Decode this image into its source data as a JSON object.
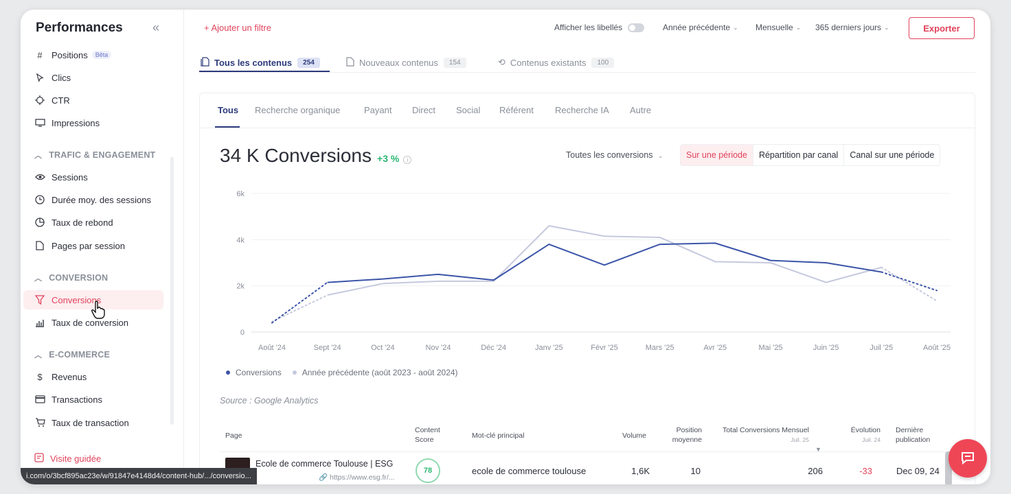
{
  "sidebar": {
    "title": "Performances",
    "collapse_icon": "double-chevron-left-icon",
    "top_items": [
      {
        "label": "Positions",
        "badge": "Bêta",
        "icon": "hash-icon"
      },
      {
        "label": "Clics",
        "icon": "cursor-icon"
      },
      {
        "label": "CTR",
        "icon": "crosshair-icon"
      },
      {
        "label": "Impressions",
        "icon": "monitor-icon"
      }
    ],
    "sections": [
      {
        "title": "TRAFIC & ENGAGEMENT",
        "items": [
          {
            "label": "Sessions",
            "icon": "eye-icon"
          },
          {
            "label": "Durée moy. des sessions",
            "icon": "clock-icon"
          },
          {
            "label": "Taux de rebond",
            "icon": "pie-icon"
          },
          {
            "label": "Pages par session",
            "icon": "page-icon"
          }
        ]
      },
      {
        "title": "CONVERSION",
        "items": [
          {
            "label": "Conversions",
            "icon": "funnel-icon",
            "active": true
          },
          {
            "label": "Taux de conversion",
            "icon": "bar-chart-icon"
          }
        ]
      },
      {
        "title": "E-COMMERCE",
        "items": [
          {
            "label": "Revenus",
            "icon": "dollar-icon"
          },
          {
            "label": "Transactions",
            "icon": "card-icon"
          },
          {
            "label": "Taux de transaction",
            "icon": "cart-icon"
          }
        ]
      }
    ],
    "footer_link": "Visite guidée"
  },
  "topbar": {
    "add_filter": "+ Ajouter un filtre",
    "show_labels": "Afficher les libellés",
    "compare": "Année précédente",
    "granularity": "Mensuelle",
    "range": "365 derniers jours",
    "export": "Exporter"
  },
  "content_tabs": [
    {
      "label": "Tous les contenus",
      "count": "254",
      "active": true
    },
    {
      "label": "Nouveaux contenus",
      "count": "154"
    },
    {
      "label": "Contenus existants",
      "count": "100"
    }
  ],
  "source_tabs": [
    "Tous",
    "Recherche organique",
    "Payant",
    "Direct",
    "Social",
    "Référent",
    "Recherche IA",
    "Autre"
  ],
  "summary": {
    "value": "34 K Conversions",
    "delta": "+3 %",
    "filter": "Toutes les conversions",
    "views": [
      "Sur une période",
      "Répartition par canal",
      "Canal sur une période"
    ]
  },
  "colors": {
    "accent": "#e0435b",
    "series_current": "#3b54a8",
    "series_previous": "#c5c9dd",
    "positive": "#2bb673"
  },
  "chart_data": {
    "type": "line",
    "categories": [
      "Août '24",
      "Sept '24",
      "Oct '24",
      "Nov '24",
      "Déc '24",
      "Janv '25",
      "Févr '25",
      "Mars '25",
      "Avr '25",
      "Mai '25",
      "Juin '25",
      "Juil '25",
      "Août '25"
    ],
    "series": [
      {
        "name": "Conversions",
        "values": [
          400,
          2150,
          2300,
          2500,
          2250,
          3800,
          2900,
          3800,
          3850,
          3100,
          3000,
          2600,
          1800
        ]
      },
      {
        "name": "Année précédente (août 2023 - août 2024)",
        "values": [
          450,
          1600,
          2100,
          2200,
          2200,
          4600,
          4150,
          4100,
          3050,
          3000,
          2150,
          2800,
          1350
        ]
      }
    ],
    "partial_first": true,
    "partial_last": true,
    "yticks": [
      "0",
      "2k",
      "4k",
      "6k"
    ],
    "ylim": [
      0,
      6000
    ],
    "grid": true,
    "legend": "bottom-left",
    "source": "Source : Google Analytics"
  },
  "table": {
    "headers": {
      "page": "Page",
      "score": "Content Score",
      "keyword": "Mot-clé principal",
      "volume": "Volume",
      "position": "Position moyenne",
      "total": "Total Conversions Mensuel",
      "total_sub": "Juil. 25",
      "evolution": "Évolution",
      "evolution_sub": "Juil. 24",
      "published": "Dernière publication"
    },
    "rows": [
      {
        "title": "Ecole de commerce Toulouse | ESG",
        "url": "https://www.esg.fr/...",
        "score": "78",
        "keyword": "ecole de commerce toulouse",
        "volume": "1,6K",
        "position": "10",
        "total": "206",
        "evolution": "-33",
        "published": "Dec 09, 24"
      }
    ]
  },
  "status_url": "i.com/o/3bcf895ac23e/w/91847e4148d4/content-hub/.../conversio..."
}
